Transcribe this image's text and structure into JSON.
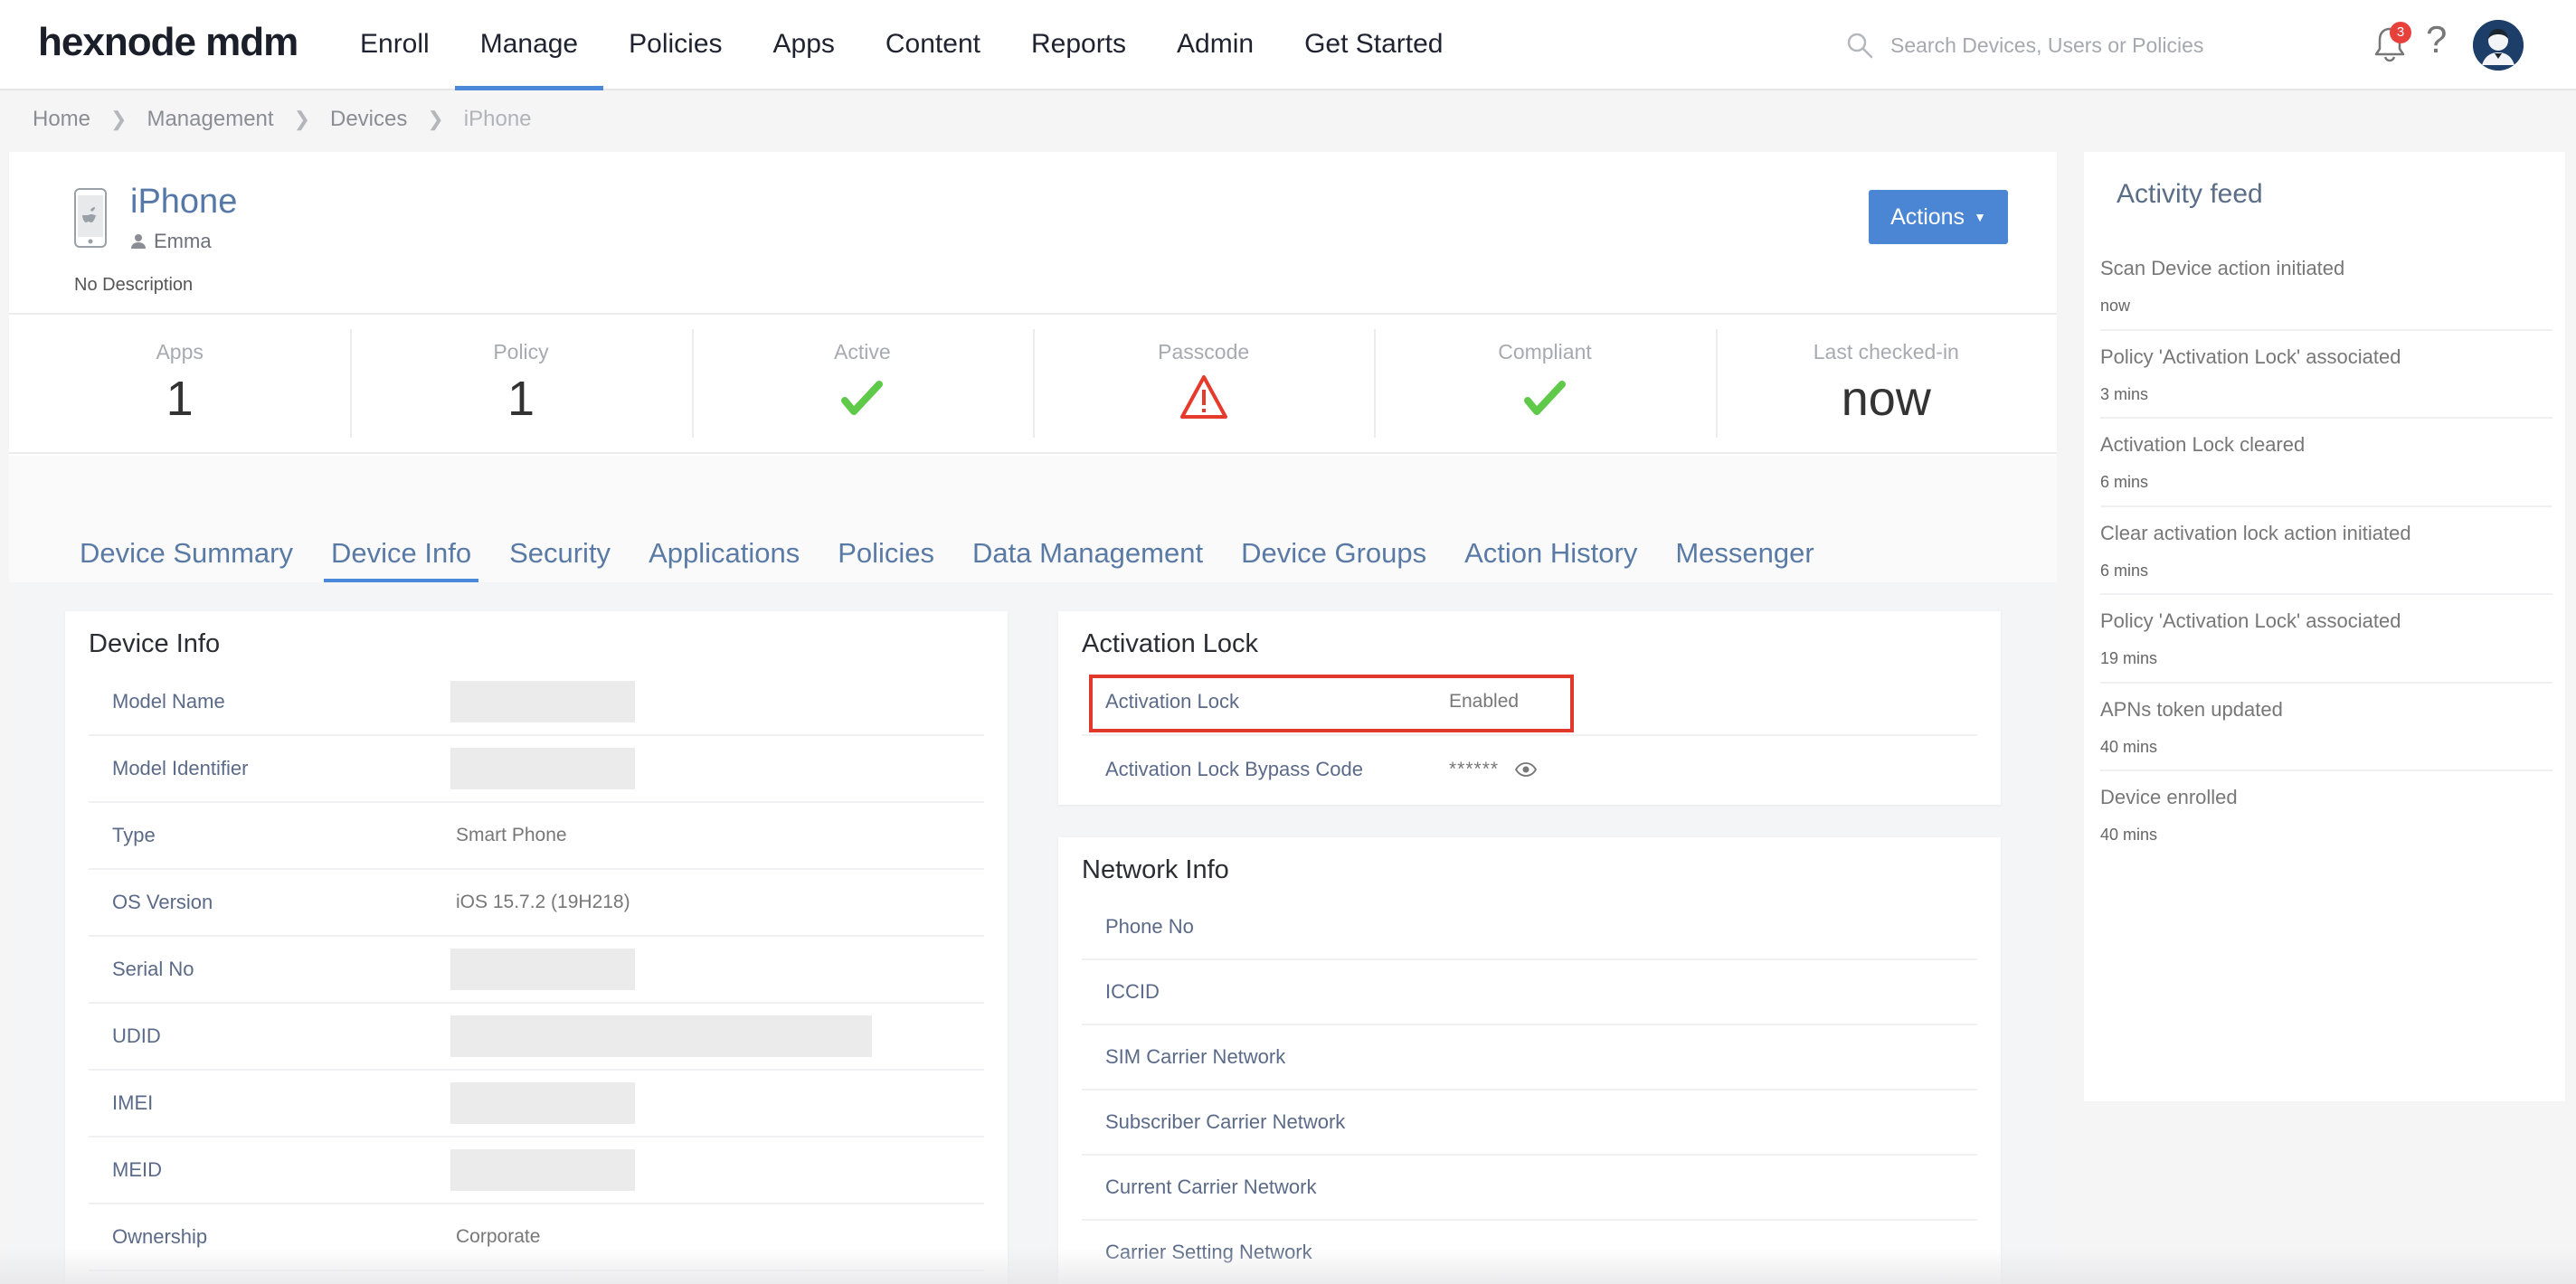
{
  "header": {
    "logo": "hexnode mdm",
    "nav": [
      "Enroll",
      "Manage",
      "Policies",
      "Apps",
      "Content",
      "Reports",
      "Admin",
      "Get Started"
    ],
    "active_nav": "Manage",
    "search_placeholder": "Search Devices, Users or Policies",
    "notification_count": "3",
    "help": "?"
  },
  "breadcrumb": [
    "Home",
    "Management",
    "Devices",
    "iPhone"
  ],
  "device": {
    "name": "iPhone",
    "user": "Emma",
    "description": "No Description",
    "actions_label": "Actions"
  },
  "stats": {
    "apps": {
      "label": "Apps",
      "value": "1"
    },
    "policy": {
      "label": "Policy",
      "value": "1"
    },
    "active": {
      "label": "Active",
      "icon": "check-icon"
    },
    "passcode": {
      "label": "Passcode",
      "icon": "warning-icon"
    },
    "compliant": {
      "label": "Compliant",
      "icon": "check-icon"
    },
    "last_checked_in": {
      "label": "Last checked-in",
      "value": "now"
    }
  },
  "tabs": [
    "Device Summary",
    "Device Info",
    "Security",
    "Applications",
    "Policies",
    "Data Management",
    "Device Groups",
    "Action History",
    "Messenger"
  ],
  "active_tab": "Device Info",
  "device_info": {
    "title": "Device Info",
    "rows": [
      {
        "label": "Model Name",
        "value": ""
      },
      {
        "label": "Model Identifier",
        "value": ""
      },
      {
        "label": "Type",
        "value": "Smart Phone"
      },
      {
        "label": "OS Version",
        "value": "iOS 15.7.2 (19H218)"
      },
      {
        "label": "Serial No",
        "value": ""
      },
      {
        "label": "UDID",
        "value": ""
      },
      {
        "label": "IMEI",
        "value": ""
      },
      {
        "label": "MEID",
        "value": ""
      },
      {
        "label": "Ownership",
        "value": "Corporate"
      }
    ]
  },
  "activation_lock": {
    "title": "Activation Lock",
    "rows": [
      {
        "label": "Activation Lock",
        "value": "Enabled"
      },
      {
        "label": "Activation Lock Bypass Code",
        "value": "******"
      }
    ]
  },
  "network_info": {
    "title": "Network Info",
    "rows": [
      "Phone No",
      "ICCID",
      "SIM Carrier Network",
      "Subscriber Carrier Network",
      "Current Carrier Network",
      "Carrier Setting Network"
    ]
  },
  "activity_feed": {
    "title": "Activity feed",
    "items": [
      {
        "text": "Scan Device action initiated",
        "time": "now"
      },
      {
        "text": "Policy 'Activation Lock' associated",
        "time": "3 mins"
      },
      {
        "text": "Activation Lock cleared",
        "time": "6 mins"
      },
      {
        "text": "Clear activation lock action initiated",
        "time": "6 mins"
      },
      {
        "text": "Policy 'Activation Lock' associated",
        "time": "19 mins"
      },
      {
        "text": "APNs token updated",
        "time": "40 mins"
      },
      {
        "text": "Device enrolled",
        "time": "40 mins"
      }
    ]
  },
  "colors": {
    "accent": "#4a88d9",
    "check": "#5fc94a",
    "warning": "#e53a2c",
    "highlight_box": "#e0382b"
  }
}
